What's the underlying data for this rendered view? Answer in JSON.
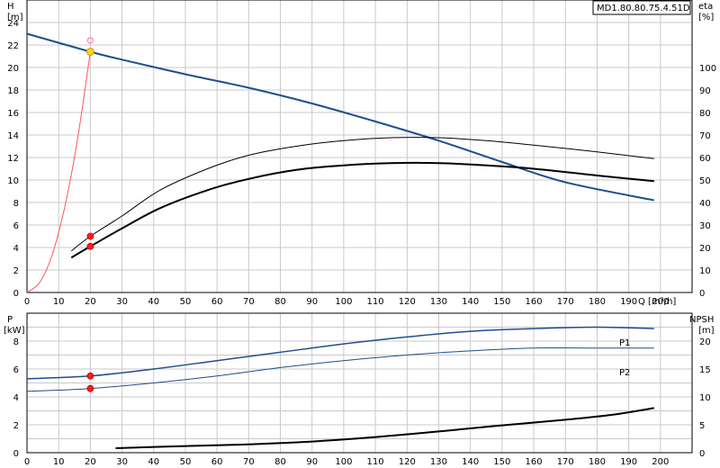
{
  "chart_data": [
    {
      "type": "line",
      "model": "MD1.80.80.75.4.51D",
      "x_label": "Q [m³/h]",
      "left_axis": {
        "title": "H",
        "unit": "[m]",
        "range": [
          0,
          26
        ],
        "ticks": [
          0,
          2,
          4,
          6,
          8,
          10,
          12,
          14,
          16,
          18,
          20,
          22,
          24
        ]
      },
      "right_axis": {
        "title": "eta",
        "unit": "[%]",
        "range": [
          0,
          130
        ],
        "ticks": [
          0,
          10,
          20,
          30,
          40,
          50,
          60,
          70,
          80,
          90,
          100
        ]
      },
      "x_range": [
        0,
        210
      ],
      "x_ticks": [
        0,
        10,
        20,
        30,
        40,
        50,
        60,
        70,
        80,
        90,
        100,
        110,
        120,
        130,
        140,
        150,
        160,
        170,
        180,
        190,
        200
      ],
      "grid": true,
      "series": [
        {
          "axis": "left",
          "color": "#1f4e8c",
          "width": 2,
          "x": [
            0,
            20,
            30,
            50,
            70,
            90,
            110,
            130,
            150,
            170,
            198
          ],
          "y": [
            23.0,
            21.4,
            20.7,
            19.4,
            18.2,
            16.8,
            15.2,
            13.5,
            11.6,
            9.8,
            8.2
          ]
        },
        {
          "axis": "right",
          "color": "#000000",
          "width": 1,
          "x": [
            14,
            20,
            30,
            42,
            57,
            70,
            85,
            100,
            115,
            130,
            145,
            160,
            180,
            198
          ],
          "y": [
            18.5,
            25,
            34,
            45.5,
            55,
            61,
            65,
            67.5,
            68.8,
            68.8,
            67.5,
            65.5,
            62.5,
            59.5
          ]
        },
        {
          "axis": "right",
          "color": "#000000",
          "width": 2,
          "x": [
            14,
            20,
            30,
            42,
            57,
            70,
            85,
            100,
            115,
            130,
            145,
            160,
            180,
            198
          ],
          "y": [
            15.5,
            20.5,
            28.5,
            37.5,
            45.5,
            50.5,
            54.5,
            56.5,
            57.5,
            57.5,
            56.5,
            55,
            52,
            49.5
          ]
        },
        {
          "axis": "left",
          "color": "#ff5555",
          "width": 1,
          "x": [
            0,
            4,
            8,
            12,
            16,
            20
          ],
          "y": [
            0,
            0.9,
            3.4,
            7.7,
            13.7,
            21.4
          ]
        }
      ],
      "points": [
        {
          "axis": "left",
          "x": 20,
          "y": 21.4,
          "shape": "yellow"
        },
        {
          "axis": "left",
          "x": 20,
          "y": 22.4,
          "shape": "open-pink"
        },
        {
          "axis": "right",
          "x": 20,
          "y": 25,
          "shape": "red"
        },
        {
          "axis": "right",
          "x": 20,
          "y": 20.5,
          "shape": "red"
        }
      ]
    },
    {
      "type": "line",
      "x_range": [
        0,
        210
      ],
      "x_ticks": [
        0,
        10,
        20,
        30,
        40,
        50,
        60,
        70,
        80,
        90,
        100,
        110,
        120,
        130,
        140,
        150,
        160,
        170,
        180,
        190,
        200
      ],
      "left_axis": {
        "title": "P",
        "unit": "[kW]",
        "range": [
          0,
          10
        ],
        "ticks": [
          0,
          2,
          4,
          6,
          8
        ]
      },
      "right_axis": {
        "title": "NPSH",
        "unit": "[m]",
        "range": [
          0,
          25
        ],
        "ticks": [
          0,
          5,
          10,
          15,
          20
        ]
      },
      "grid": true,
      "series": [
        {
          "name": "P1",
          "axis": "left",
          "color": "#1f4e8c",
          "width": 1.5,
          "x": [
            0,
            20,
            40,
            60,
            80,
            100,
            120,
            140,
            160,
            180,
            198
          ],
          "y": [
            5.3,
            5.5,
            6.0,
            6.6,
            7.2,
            7.8,
            8.3,
            8.7,
            8.9,
            9.0,
            8.9
          ]
        },
        {
          "name": "P2",
          "axis": "left",
          "color": "#1f4e8c",
          "width": 1,
          "x": [
            0,
            20,
            40,
            60,
            80,
            100,
            120,
            140,
            160,
            180,
            198
          ],
          "y": [
            4.4,
            4.6,
            5.0,
            5.5,
            6.1,
            6.6,
            7.0,
            7.3,
            7.5,
            7.5,
            7.5
          ]
        },
        {
          "axis": "right",
          "color": "#000000",
          "width": 2,
          "x": [
            28,
            50,
            70,
            90,
            110,
            130,
            150,
            170,
            185,
            198
          ],
          "y": [
            0.8,
            1.2,
            1.5,
            2.0,
            2.8,
            3.8,
            4.9,
            5.9,
            6.8,
            8.0
          ]
        }
      ],
      "points": [
        {
          "axis": "left",
          "x": 20,
          "y": 5.5,
          "shape": "red"
        },
        {
          "axis": "left",
          "x": 20,
          "y": 4.6,
          "shape": "red"
        }
      ]
    }
  ]
}
